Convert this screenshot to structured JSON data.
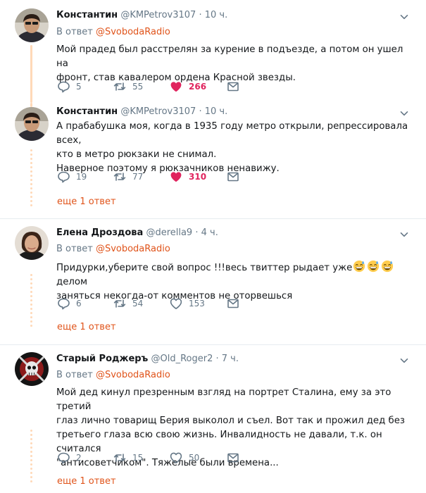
{
  "colors": {
    "accent": "#e0541b",
    "like": "#e0245e",
    "muted": "#657786",
    "thread": "#ffd9b8"
  },
  "tweets": [
    {
      "author": "Константин",
      "handle": "@KMPetrov3107",
      "time": "· 10 ч.",
      "reply_prefix": "В ответ",
      "reply_to": "@SvobodaRadio",
      "lines": [
        "Мой прадед был расстрелян за курение в подъезде, а потом он ушел на",
        "фронт, став кавалером ордена Красной звезды."
      ],
      "replies": "5",
      "retweets": "55",
      "likes": "266",
      "liked": true
    },
    {
      "author": "Константин",
      "handle": "@KMPetrov3107",
      "time": "· 10 ч.",
      "lines": [
        "А прабабушка моя, когда в 1935 году метро открыли, репрессировала всех,",
        "кто в метро рюкзаки не снимал.",
        "Наверное поэтому я рюкзачников ненавижу."
      ],
      "replies": "19",
      "retweets": "77",
      "likes": "310",
      "liked": true,
      "more_replies": "еще 1 ответ"
    },
    {
      "author": "Елена Дроздова",
      "handle": "@derella9",
      "time": "· 4 ч.",
      "reply_prefix": "В ответ",
      "reply_to": "@SvobodaRadio",
      "line1_before_emoji": "Придурки,уберите свой вопрос !!!весь твиттер рыдает уже",
      "line1_after_emoji": "делом",
      "emoji": [
        "grinning-sweat-emoji",
        "grinning-sweat-emoji",
        "grinning-sweat-emoji"
      ],
      "line2": "заняться некогда-от комментов не оторвешься",
      "replies": "6",
      "retweets": "54",
      "likes": "153",
      "liked": false,
      "more_replies": "еще 1 ответ"
    },
    {
      "author": "Старый Роджеръ",
      "handle": "@Old_Roger2",
      "time": "· 7 ч.",
      "reply_prefix": "В ответ",
      "reply_to": "@SvobodaRadio",
      "lines": [
        "Мой дед кинул презренным взгляд на портрет Сталина, ему за это третий",
        "глаз лично товарищ Берия выколол и съел. Вот так и прожил дед без",
        "третьего глаза всю свою жизнь. Инвалидность не давали, т.к. он считался",
        "\"антисоветчиком\". Тяжелые были времена..."
      ],
      "replies": "2",
      "retweets": "15",
      "likes": "50",
      "liked": false,
      "more_replies": "еще 1 ответ"
    }
  ]
}
